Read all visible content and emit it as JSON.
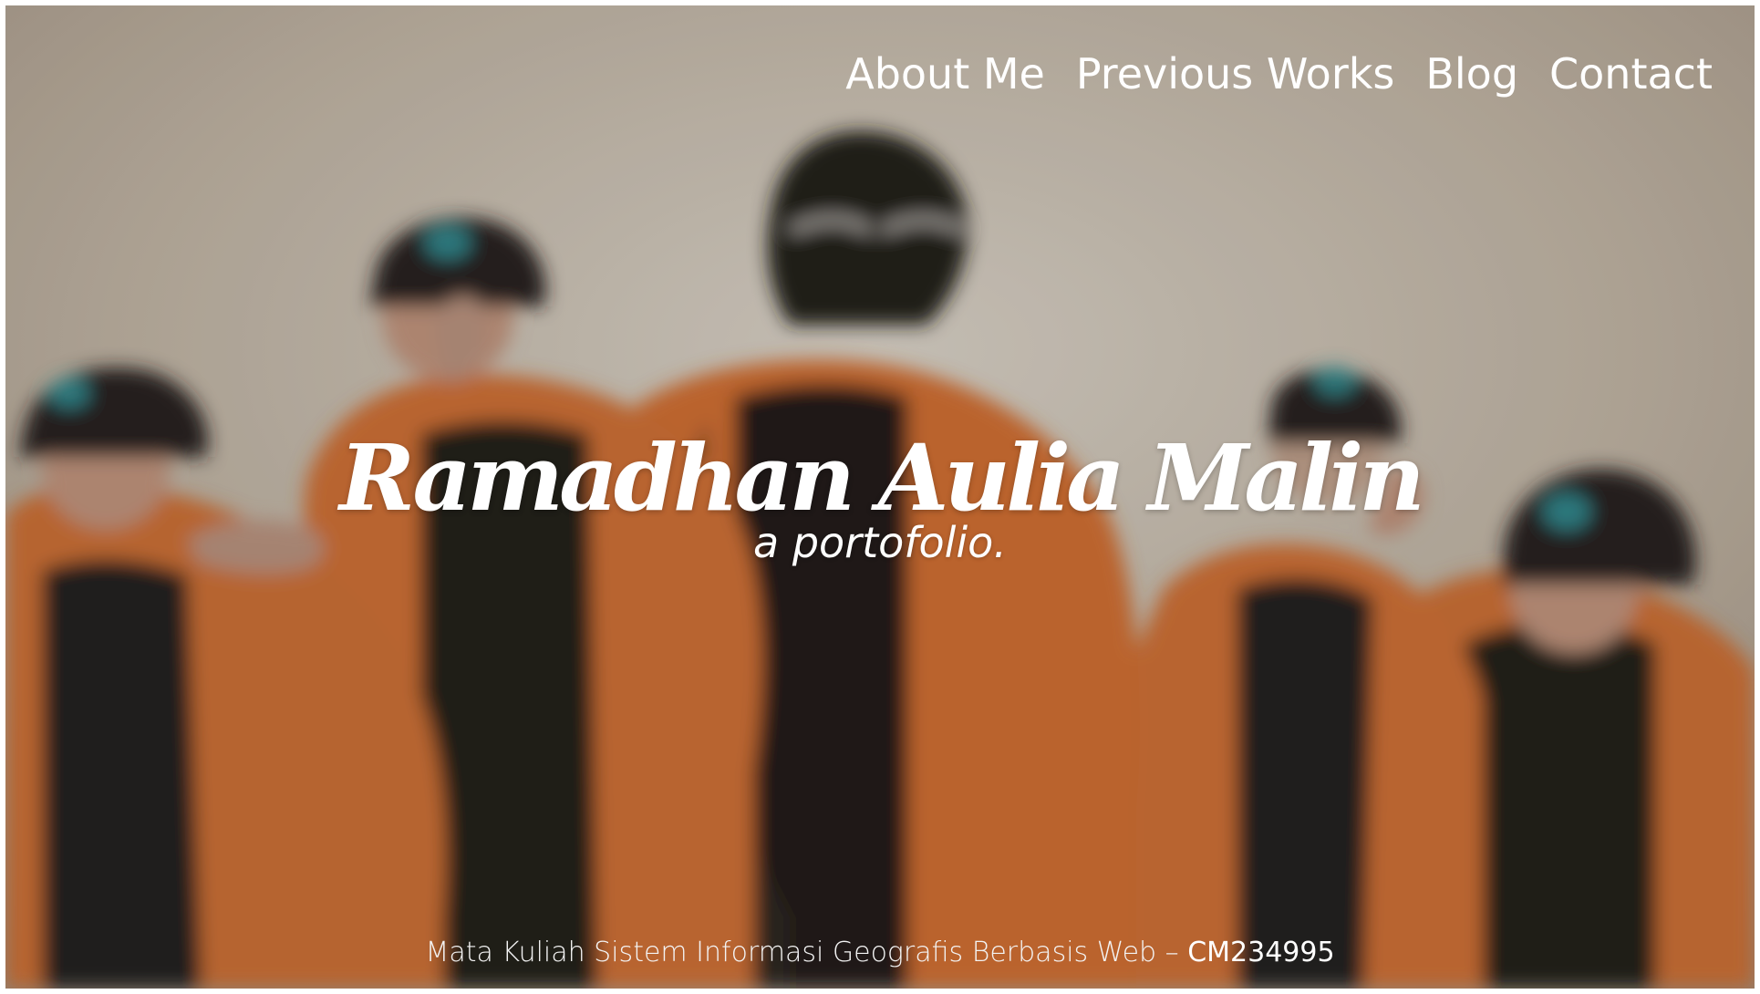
{
  "nav": {
    "items": [
      {
        "label": "About Me"
      },
      {
        "label": "Previous Works"
      },
      {
        "label": "Blog"
      },
      {
        "label": "Contact"
      }
    ]
  },
  "hero": {
    "title": "Ramadhan Aulia Malin",
    "subtitle": "a portofolio."
  },
  "footer": {
    "text": "Mata Kuliah Sistem Informasi Geografis Berbasis Web – ",
    "code": "CM234995"
  },
  "colors": {
    "text": "#ffffff",
    "jacket_orange": "#c8692e",
    "shirt_black": "#1d1a18",
    "background_warm_gray": "#b6ab9b"
  },
  "icons": {
    "hat_badge": "mountain-badge-icon"
  }
}
